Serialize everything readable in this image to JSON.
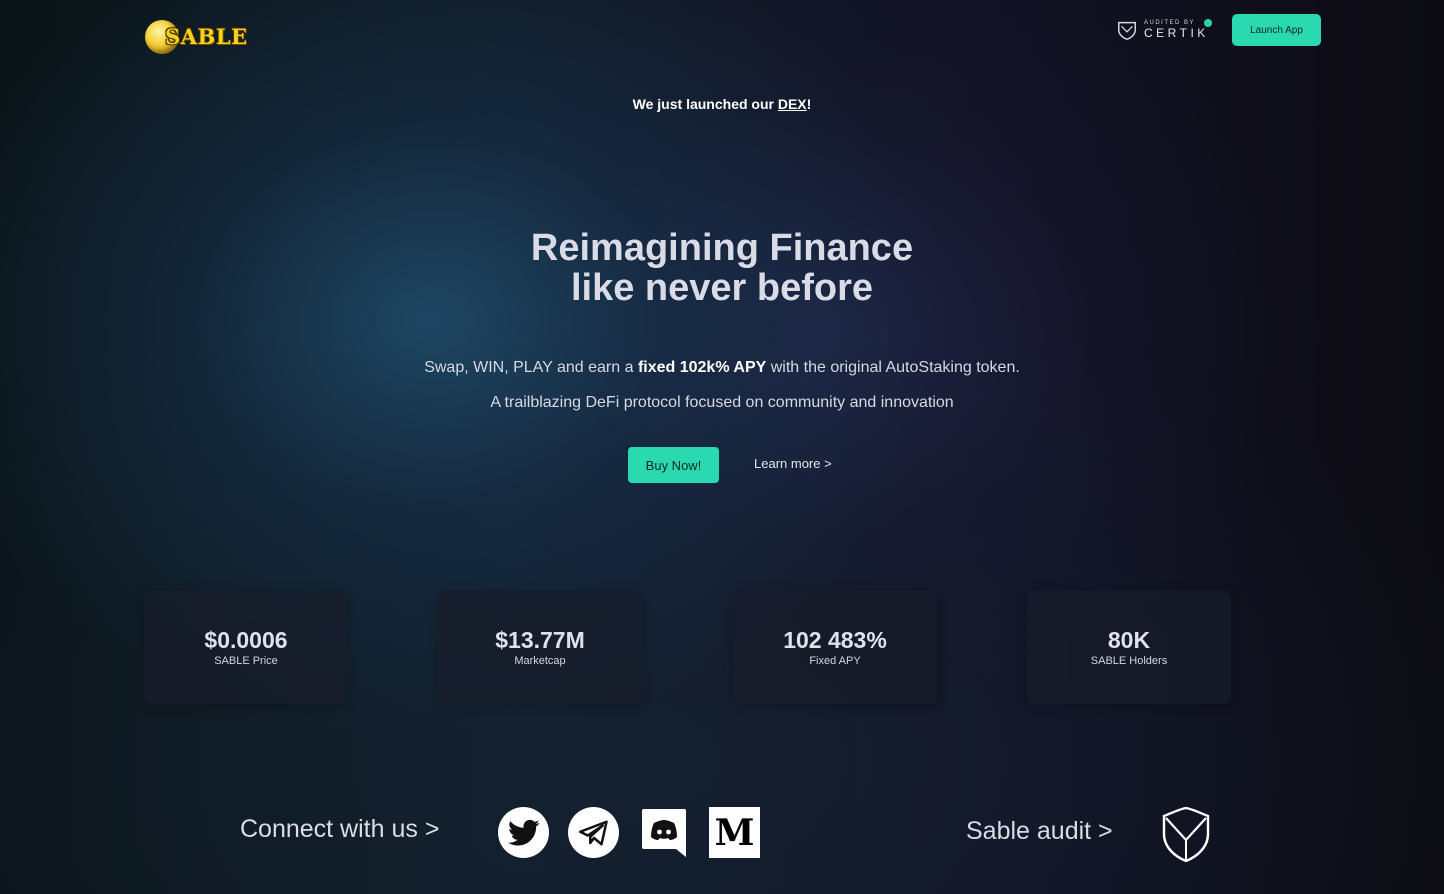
{
  "header": {
    "logo_text": "SABLE",
    "certik_small": "AUDITED BY",
    "certik_big": "CERTIK",
    "launch_label": "Launch App"
  },
  "announcement": {
    "prefix": "We just launched our ",
    "link": "DEX",
    "suffix": "!"
  },
  "hero": {
    "title_line1": "Reimagining Finance",
    "title_line2": "like never before",
    "sub1_prefix": "Swap, WIN, PLAY and earn a ",
    "sub1_bold": "fixed 102k% APY",
    "sub1_suffix": " with the original AutoStaking token.",
    "sub2": "A trailblazing DeFi protocol focused on community and innovation",
    "buy_label": "Buy Now!",
    "learn_label": "Learn more >"
  },
  "stats": [
    {
      "value": "$0.0006",
      "label": "SABLE Price"
    },
    {
      "value": "$13.77M",
      "label": "Marketcap"
    },
    {
      "value": "102 483%",
      "label": "Fixed APY"
    },
    {
      "value": "80K",
      "label": "SABLE Holders"
    }
  ],
  "footer": {
    "connect_label": "Connect with us >",
    "socials": [
      "twitter-icon",
      "telegram-icon",
      "discord-icon",
      "medium-icon"
    ],
    "medium_letter": "M",
    "audit_label": "Sable audit >"
  },
  "colors": {
    "accent": "#2bd9b0",
    "logo_yellow": "#f7d21d"
  }
}
